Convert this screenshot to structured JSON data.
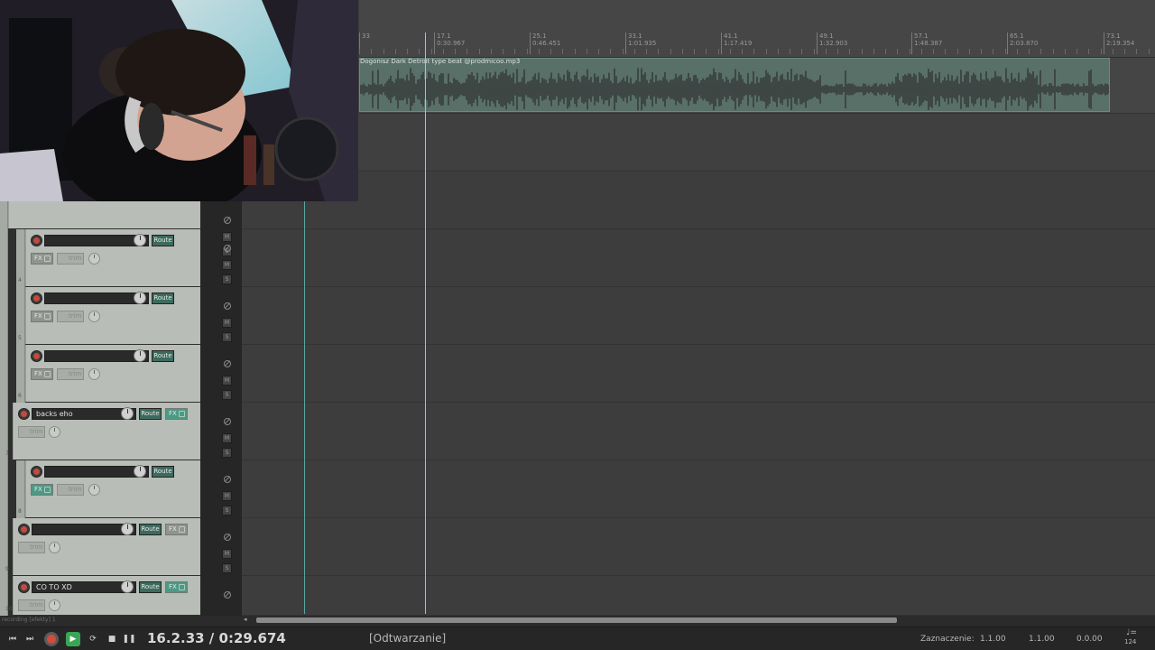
{
  "ruler": {
    "ticks": [
      {
        "bar": "33",
        "time": ""
      },
      {
        "bar": "17.1",
        "time": "0:30.967"
      },
      {
        "bar": "25.1",
        "time": "0:46.451"
      },
      {
        "bar": "33.1",
        "time": "1:01.935"
      },
      {
        "bar": "41.1",
        "time": "1:17.419"
      },
      {
        "bar": "49.1",
        "time": "1:32.903"
      },
      {
        "bar": "57.1",
        "time": "1:48.387"
      },
      {
        "bar": "65.1",
        "time": "2:03.870"
      },
      {
        "bar": "73.1",
        "time": "2:19.354"
      }
    ]
  },
  "media_item": {
    "label": "Dogonisz Dark Detroit type beat @prodmicoo.mp3"
  },
  "tracks": [
    {
      "number": "4",
      "name": "",
      "fx_active": false
    },
    {
      "number": "5",
      "name": "",
      "fx_active": false
    },
    {
      "number": "6",
      "name": "",
      "fx_active": false
    },
    {
      "number": "7",
      "name": "backs eho",
      "fx_active": true
    },
    {
      "number": "8",
      "name": "",
      "fx_active": true
    },
    {
      "number": "9",
      "name": "",
      "fx_active": false
    },
    {
      "number": "10",
      "name": "CO TO XD",
      "fx_active": true
    }
  ],
  "labels": {
    "route": "Route",
    "fx": "FX",
    "trim": "trim",
    "mute": "M",
    "solo": "S"
  },
  "status_line": "recording [efekty] 1",
  "transport": {
    "time": "16.2.33 / 0:29.674",
    "state": "[Odtwarzanie]",
    "selection_label": "Zaznaczenie:",
    "sel_start": "1.1.00",
    "sel_end": "1.1.00",
    "sel_length": "0.0.00",
    "bpm": "124"
  },
  "colors": {
    "accent_route": "#3c6b5e",
    "fx_active": "#4a9a84",
    "record": "#d24b3c",
    "play": "#3aa655",
    "playhead": "#cbc55a"
  }
}
